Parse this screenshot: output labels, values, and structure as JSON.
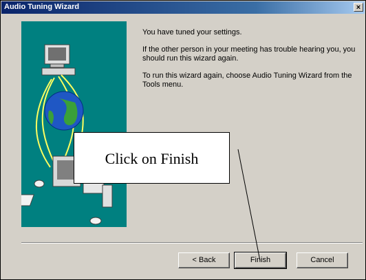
{
  "window": {
    "title": "Audio Tuning Wizard",
    "close_label": "×"
  },
  "content": {
    "paragraphs": [
      "You have tuned your settings.",
      "If the other person in your meeting has trouble hearing you, you should run this wizard again.",
      "To run this wizard again, choose Audio Tuning Wizard from the Tools menu."
    ]
  },
  "buttons": {
    "back": "< Back",
    "finish": "Finish",
    "cancel": "Cancel"
  },
  "annotation": {
    "callout": "Click on Finish"
  },
  "colors": {
    "dialog_bg": "#d4d0c8",
    "title_bar": "#0a246a",
    "art_panel_bg": "#008080"
  },
  "icons": [
    "computer-icon",
    "globe-icon",
    "computer-tower-icon",
    "close-icon"
  ]
}
